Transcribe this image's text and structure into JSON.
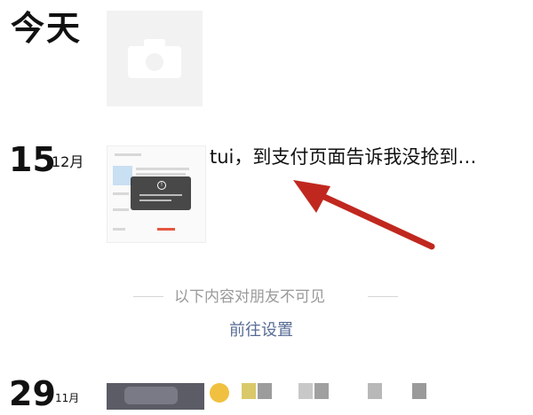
{
  "feed": {
    "today_label": "今天",
    "entry_dec15": {
      "day": "15",
      "month": "12月",
      "text": "tui，到支付页面告诉我没抢到…"
    },
    "invisible_notice": "以下内容对朋友不可见",
    "settings_link": "前往设置",
    "entry_nov29": {
      "day": "29",
      "month": "11月"
    }
  },
  "colors": {
    "link": "#576b95",
    "arrow": "#c0281f",
    "divider_text": "#9a9a9a"
  },
  "icons": {
    "placeholder": "camera-icon",
    "toast": "info-icon"
  }
}
